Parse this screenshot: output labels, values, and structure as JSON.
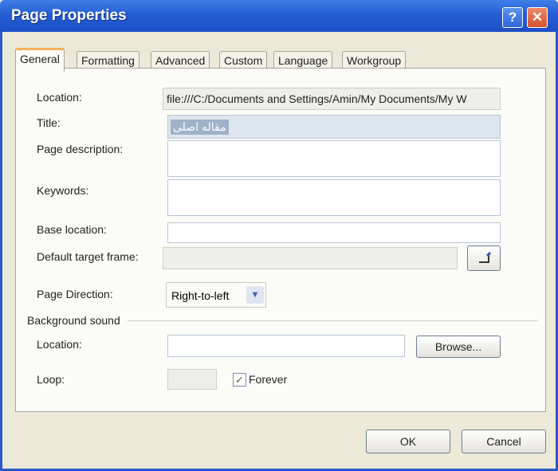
{
  "window": {
    "title": "Page Properties",
    "help_glyph": "?",
    "close_glyph": "✕"
  },
  "tabs": [
    {
      "label": "General",
      "active": true
    },
    {
      "label": "Formatting",
      "active": false
    },
    {
      "label": "Advanced",
      "active": false
    },
    {
      "label": "Custom",
      "active": false
    },
    {
      "label": "Language",
      "active": false
    },
    {
      "label": "Workgroup",
      "active": false
    }
  ],
  "general": {
    "location_label": "Location:",
    "location_value": "file:///C:/Documents and Settings/Amin/My Documents/My W",
    "title_label": "Title:",
    "title_value": "مقاله اصلی",
    "page_description_label": "Page description:",
    "page_description_value": "",
    "keywords_label": "Keywords:",
    "keywords_value": "",
    "base_location_label": "Base location:",
    "base_location_value": "",
    "default_target_frame_label": "Default target frame:",
    "default_target_frame_value": "",
    "page_direction_label": "Page Direction:",
    "page_direction_value": "Right-to-left",
    "background_sound_label": "Background sound",
    "sound_location_label": "Location:",
    "sound_location_value": "",
    "browse_label": "Browse...",
    "loop_label": "Loop:",
    "loop_value": "",
    "forever_label": "Forever",
    "forever_checked": true
  },
  "footer": {
    "ok_label": "OK",
    "cancel_label": "Cancel"
  },
  "colors": {
    "titlebar": "#245ed6",
    "active_tab_accent": "#f0b35b",
    "dialog_bg": "#ece9d8"
  },
  "icons": {
    "frame_picker": "pencil-icon",
    "dropdown": "chevron-down-icon",
    "help": "help-icon",
    "close": "close-icon"
  }
}
